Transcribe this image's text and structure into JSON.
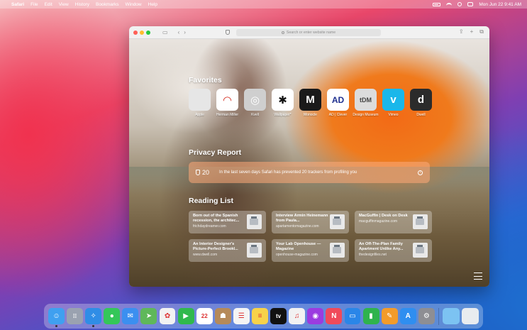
{
  "menubar": {
    "app_name": "Safari",
    "items": [
      "File",
      "Edit",
      "View",
      "History",
      "Bookmarks",
      "Window",
      "Help"
    ],
    "clock": "Mon Jun 22  9:41 AM"
  },
  "browser": {
    "address_placeholder": "Search or enter website name"
  },
  "favorites": {
    "title": "Favorites",
    "items": [
      {
        "label": "Apple",
        "glyph": "",
        "bg": "#e6e6e6",
        "fg": "#555555"
      },
      {
        "label": "Herman Miller",
        "glyph": "◠",
        "bg": "#ffffff",
        "fg": "#d42c1f"
      },
      {
        "label": "Kvell",
        "glyph": "◎",
        "bg": "#cfcfcf",
        "fg": "#ffffff"
      },
      {
        "label": "Wallpaper*",
        "glyph": "✱",
        "bg": "#ffffff",
        "fg": "#111111"
      },
      {
        "label": "Monocle",
        "glyph": "M",
        "bg": "#1a1a1a",
        "fg": "#ffffff"
      },
      {
        "label": "AD | Clever",
        "glyph": "AD",
        "bg": "#ffffff",
        "fg": "#1e2f8f"
      },
      {
        "label": "Design Museum",
        "glyph": "tDM",
        "bg": "#dcdcdc",
        "fg": "#444444"
      },
      {
        "label": "Vimeo",
        "glyph": "v",
        "bg": "#1ab7ea",
        "fg": "#ffffff"
      },
      {
        "label": "Dwell",
        "glyph": "d",
        "bg": "#2b2b2b",
        "fg": "#ffffff"
      }
    ]
  },
  "privacy": {
    "title": "Privacy Report",
    "count": "20",
    "message": "In the last seven days Safari has prevented 20 trackers from profiling you"
  },
  "reading_list": {
    "title": "Reading List",
    "items": [
      {
        "title": "Born out of the Spanish recession, the architec...",
        "url": "frichdaydreamer.com"
      },
      {
        "title": "Interview Armin Heinemann from Paula...",
        "url": "apartamentomagazine.com"
      },
      {
        "title": "MacGuffin | Desk on Desk",
        "url": "macguffinmagazine.com"
      },
      {
        "title": "An Interior Designer's Picture-Perfect Brookl...",
        "url": "www.dwell.com"
      },
      {
        "title": "Your Lab Openhouse — Magazine",
        "url": "openhouse-magazine.com"
      },
      {
        "title": "An Off-The-Plan Family Apartment Unlike Any...",
        "url": "thedesignfiles.net"
      }
    ]
  },
  "dock": {
    "apps": [
      {
        "name": "finder-icon",
        "glyph": "☺",
        "bg": "#3fa0f0",
        "dot": true
      },
      {
        "name": "launchpad-icon",
        "glyph": "⁞⁞",
        "bg": "#9aa2b0",
        "dot": false
      },
      {
        "name": "safari-icon",
        "glyph": "✧",
        "bg": "#2f8de6",
        "dot": true
      },
      {
        "name": "messages-icon",
        "glyph": "●",
        "bg": "#34c759",
        "dot": false
      },
      {
        "name": "mail-icon",
        "glyph": "✉",
        "bg": "#3b8ff0",
        "dot": false
      },
      {
        "name": "maps-icon",
        "glyph": "➤",
        "bg": "#5fb85a",
        "dot": false
      },
      {
        "name": "photos-icon",
        "glyph": "✿",
        "bg": "#f2f2f2",
        "dot": false
      },
      {
        "name": "facetime-icon",
        "glyph": "▶",
        "bg": "#30b94d",
        "dot": false
      },
      {
        "name": "calendar-icon",
        "glyph": "22",
        "bg": "#ffffff",
        "dot": false
      },
      {
        "name": "contacts-icon",
        "glyph": "☗",
        "bg": "#b58a5a",
        "dot": false
      },
      {
        "name": "reminders-icon",
        "glyph": "☰",
        "bg": "#f4f4f4",
        "dot": false
      },
      {
        "name": "notes-icon",
        "glyph": "≡",
        "bg": "#f7d24a",
        "dot": false
      },
      {
        "name": "tv-icon",
        "glyph": "tv",
        "bg": "#111111",
        "dot": false
      },
      {
        "name": "music-icon",
        "glyph": "♫",
        "bg": "#f2f2f2",
        "dot": false
      },
      {
        "name": "podcasts-icon",
        "glyph": "◉",
        "bg": "#9b3be0",
        "dot": false
      },
      {
        "name": "news-icon",
        "glyph": "N",
        "bg": "#f04a5a",
        "dot": false
      },
      {
        "name": "keynote-icon",
        "glyph": "▭",
        "bg": "#2a86e8",
        "dot": false
      },
      {
        "name": "numbers-icon",
        "glyph": "▮",
        "bg": "#2fb34d",
        "dot": false
      },
      {
        "name": "pages-icon",
        "glyph": "✎",
        "bg": "#f39b2a",
        "dot": false
      },
      {
        "name": "app-store-icon",
        "glyph": "A",
        "bg": "#2f8ef0",
        "dot": false
      },
      {
        "name": "system-preferences-icon",
        "glyph": "⚙",
        "bg": "#8e8e93",
        "dot": false
      }
    ],
    "folder": {
      "name": "downloads-folder-icon",
      "glyph": "",
      "bg": "#7cc3f2"
    },
    "trash": {
      "name": "trash-icon",
      "glyph": "",
      "bg": "#e8ecef"
    }
  }
}
